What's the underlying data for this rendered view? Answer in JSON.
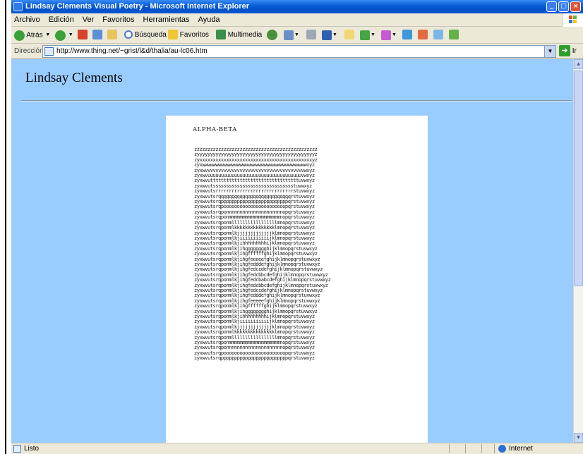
{
  "window": {
    "title": "Lindsay Clements Visual Poetry - Microsoft Internet Explorer",
    "buttons": [
      "_",
      "□",
      "×"
    ]
  },
  "menu": {
    "items": [
      "Archivo",
      "Edición",
      "Ver",
      "Favoritos",
      "Herramientas",
      "Ayuda"
    ]
  },
  "toolbar": {
    "back_label": "Atrás",
    "search_label": "Búsqueda",
    "favorites_label": "Favoritos",
    "media_label": "Multimedia"
  },
  "address": {
    "label": "Dirección",
    "url": "http://www.thing.net/~grist/l&d/thalia/au-lc06.htm",
    "go_label": "Ir"
  },
  "page": {
    "heading": "Lindsay Clements",
    "poem_title": "ALPHA-BETA",
    "poem_lines": [
      "zzzzzzzzzzzzzzzzzzzzzzzzzzzzzzzzzzzzzzzzzzzzzz",
      "zyyyyyyyyyyyyyyyyyyyyyyyyyyyyyyyyyyyyyyyyyyyyz",
      "zyxxxxxxxxxxxxxxxxxxxxxxxxxxxxxxxxxxxxxxxxxxyz",
      "zyxwwwwwwwwwwwwwwwwwwwwwwwwwwwwwwwwwwwwwwwxyz",
      "zyxwvvvvvvvvvvvvvvvvvvvvvvvvvvvvvvvvvvvvvwxyz",
      "zyxwvuuuuuuuuuuuuuuuuuuuuuuuuuuuuuuuuuuuvwxyz",
      "zyxwvutttttttttttttttttttttttttttttttttuvwxyz",
      "zyxwvutsssssssssssssssssssssssssssssstuvwxyz",
      "zyxwvutsrrrrrrrrrrrrrrrrrrrrrrrrrrrrrstuvwxyz",
      "zyxwvutsrqqqqqqqqqqqqqqqqqqqqqqqqqqqrstuvwxyz",
      "zyxwvutsrqpppppppppppppppppppppppppqrstuvwxyz",
      "zyxwvutsrqpooooooooooooooooooooooopqrstuvwxyz",
      "zyxwvutsrqponnnnnnnnnnnnnnnnnnnnnopqrstuvwxyz",
      "zyxwvutsrqponmmmmmmmmmmmmmmmmmmmnopqrstuvwxyz",
      "zyxwvutsrqponmlllllllllllllllllmnopqrstuvwxyz",
      "zyxwvutsrqponmlkkkkkkkkkkkkkkklmnopqrstuvwxyz",
      "zyxwvutsrqponmlkjjjjjjjjjjjjjklmnopqrstuvwxyz",
      "zyxwvutsrqponmlkjiiiiiiiiiiijklmnopqrstuvwxyz",
      "zyxwvutsrqponmlkjihhhhhhhhhijklmnopqrstuvwxyz",
      "zyxwvutsrqponmlkjihgggggggghijklmnopqrstuvwxyz",
      "zyxwvutsrqponmlkjihgffffffghijklmnopqrstuvwxyz",
      "zyxwvutsrqponmlkjihgfeeeeefghijklmnopqrstuvwxyz",
      "zyxwvutsrqponmlkjihgfedddefghijklmnopqrstuvwxyz",
      "zyxwvutsrqponmlkjihgfedccdefghijklmnopqrstuvwxyz",
      "zyxwvutsrqponmlkjihgfedcbbcdefghijklmnopqrstuvwxyz",
      "zyxwvutsrqponmlkjihgfedcbabcdefghijklmnopqrstuvwxyz",
      "zyxwvutsrqponmlkjihgfedcbbcdefghijklmnopqrstuvwxyz",
      "zyxwvutsrqponmlkjihgfedccdefghijklmnopqrstuvwxyz",
      "zyxwvutsrqponmlkjihgfedddefghijklmnopqrstuvwxyz",
      "zyxwvutsrqponmlkjihgfeeeeefghijklmnopqrstuvwxyz",
      "zyxwvutsrqponmlkjihgffffffghijklmnopqrstuvwxyz",
      "zyxwvutsrqponmlkjihgggggggghijklmnopqrstuvwxyz",
      "zyxwvutsrqponmlkjihhhhhhhhhijklmnopqrstuvwxyz",
      "zyxwvutsrqponmlkjiiiiiiiiiiijklmnopqrstuvwxyz",
      "zyxwvutsrqponmlkjjjjjjjjjjjjjklmnopqrstuvwxyz",
      "zyxwvutsrqponmlkkkkkkkkkkkkkkklmnopqrstuvwxyz",
      "zyxwvutsrqponmlllllllllllllllllmnopqrstuvwxyz",
      "zyxwvutsrqponmmmmmmmmmmmmmmmmmmmnopqrstuvwxyz",
      "zyxwvutsrqponnnnnnnnnnnnnnnnnnnnnopqrstuvwxyz",
      "zyxwvutsrqpooooooooooooooooooooooopqrstuvwxyz",
      "zyxwvutsrqpppppppppppppppppppppppppqrstuvwxyz"
    ]
  },
  "status": {
    "text": "Listo",
    "zone": "Internet"
  },
  "colors": {
    "page_background": "#99ccff",
    "titlebar": "#0a5fd6"
  }
}
